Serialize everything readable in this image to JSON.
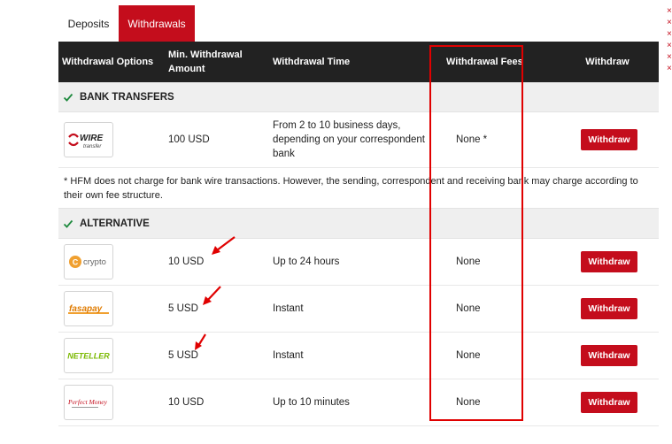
{
  "tabs": [
    {
      "label": "Deposits",
      "active": false
    },
    {
      "label": "Withdrawals",
      "active": true
    }
  ],
  "headers": {
    "options": "Withdrawal Options",
    "min": "Min. Withdrawal Amount",
    "time": "Withdrawal Time",
    "fees": "Withdrawal Fees",
    "withdraw": "Withdraw"
  },
  "sections": {
    "bank": "BANK TRANSFERS",
    "alternative": "ALTERNATIVE"
  },
  "bank_row": {
    "logo": {
      "brand": "WIRE",
      "sub": "transfer"
    },
    "min": "100 USD",
    "time": "From 2 to 10 business days, depending on your correspondent bank",
    "fees": "None *",
    "button": "Withdraw"
  },
  "note": "* HFM does not charge for bank wire transactions. However, the sending, correspondent and receiving bank may charge according to their own fee structure.",
  "alt_rows": [
    {
      "logo": "crypto",
      "min": "10 USD",
      "time": "Up to 24 hours",
      "fees": "None",
      "button": "Withdraw"
    },
    {
      "logo": "fasapay",
      "min": "5 USD",
      "time": "Instant",
      "fees": "None",
      "button": "Withdraw"
    },
    {
      "logo": "NETELLER",
      "min": "5 USD",
      "time": "Instant",
      "fees": "None",
      "button": "Withdraw"
    },
    {
      "logo": "Perfect Money",
      "min": "10 USD",
      "time": "Up to 10 minutes",
      "fees": "None",
      "button": "Withdraw"
    }
  ],
  "edge_marks": [
    "×",
    "×",
    "×",
    "×",
    "×",
    "×"
  ],
  "colors": {
    "brand_red": "#c40d1c",
    "header_bg": "#222222",
    "annotation_red": "#e00000"
  }
}
